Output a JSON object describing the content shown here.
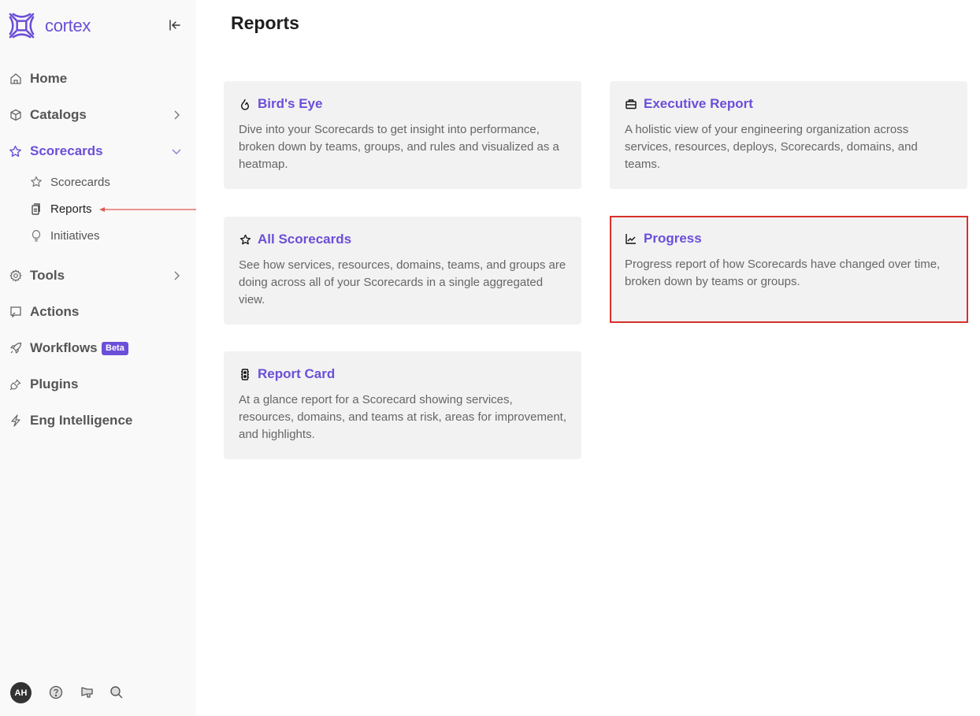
{
  "app": {
    "brand": "cortex",
    "brand_color": "#6b4fd8",
    "highlight_color": "#d9302b"
  },
  "sidebar": {
    "collapse_icon": "collapse-left-icon",
    "items": [
      {
        "label": "Home",
        "icon": "home-icon",
        "chevron": null
      },
      {
        "label": "Catalogs",
        "icon": "cube-icon",
        "chevron": "right"
      },
      {
        "label": "Scorecards",
        "icon": "star-icon",
        "chevron": "down",
        "active": true,
        "children": [
          {
            "label": "Scorecards",
            "icon": "star-icon"
          },
          {
            "label": "Reports",
            "icon": "document-icon",
            "current": true
          },
          {
            "label": "Initiatives",
            "icon": "lightbulb-icon"
          }
        ]
      },
      {
        "label": "Tools",
        "icon": "gear-icon",
        "chevron": "right"
      },
      {
        "label": "Actions",
        "icon": "actions-icon",
        "chevron": null
      },
      {
        "label": "Workflows",
        "icon": "rocket-icon",
        "chevron": null,
        "badge": "Beta"
      },
      {
        "label": "Plugins",
        "icon": "plug-icon",
        "chevron": null
      },
      {
        "label": "Eng Intelligence",
        "icon": "lightning-icon",
        "chevron": null
      }
    ],
    "footer": {
      "avatar_initials": "AH",
      "icons": [
        "help-icon",
        "megaphone-icon",
        "search-icon"
      ]
    }
  },
  "main": {
    "title": "Reports",
    "cards": [
      {
        "title": "Bird's Eye",
        "icon": "flame-icon",
        "description": "Dive into your Scorecards to get insight into performance, broken down by teams, groups, and rules and visualized as a heatmap."
      },
      {
        "title": "Executive Report",
        "icon": "briefcase-icon",
        "description": "A holistic view of your engineering organization across services, resources, deploys, Scorecards, domains, and teams."
      },
      {
        "title": "All Scorecards",
        "icon": "star-icon",
        "description": "See how services, resources, domains, teams, and groups are doing across all of your Scorecards in a single aggregated view."
      },
      {
        "title": "Progress",
        "icon": "line-chart-icon",
        "description": "Progress report of how Scorecards have changed over time, broken down by teams or groups.",
        "highlighted": true
      },
      {
        "title": "Report Card",
        "icon": "report-card-icon",
        "description": "At a glance report for a Scorecard showing services, resources, domains, and teams at risk, areas for improvement, and highlights."
      }
    ]
  }
}
